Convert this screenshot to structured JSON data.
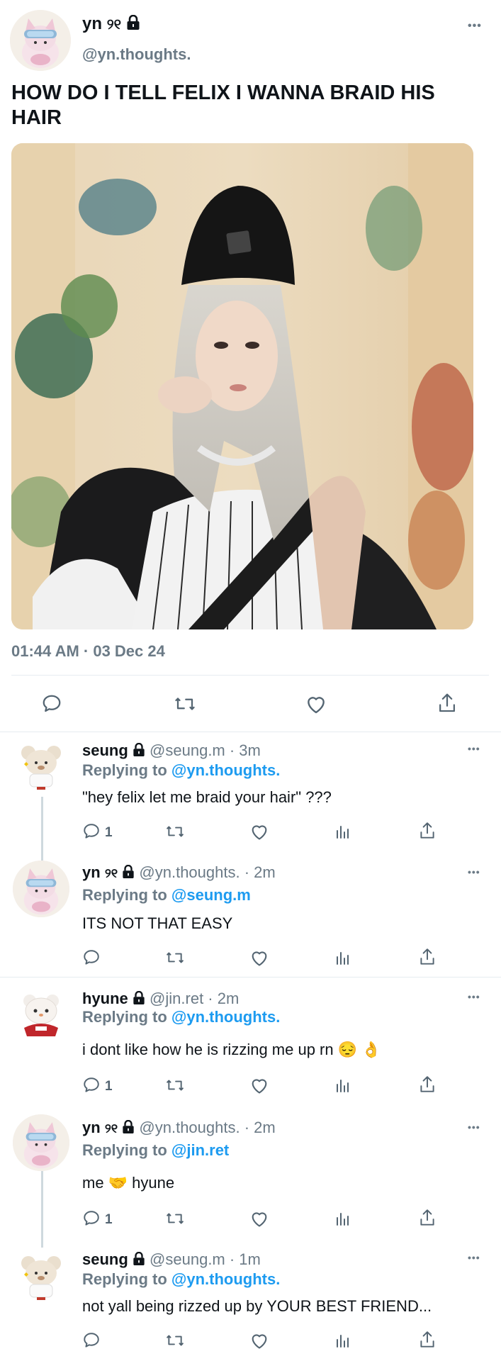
{
  "main_tweet": {
    "display_name": "yn",
    "name_symbol": "୨୧",
    "handle": "@yn.thoughts.",
    "text": "HOW DO I TELL FELIX I WANNA BRAID HIS HAIR",
    "timestamp": "01:44 AM · 03 Dec 24",
    "more": "•••"
  },
  "replies": [
    {
      "display_name": "seung",
      "handle_time": "@seung.m · 3m",
      "replying_label": "Replying to",
      "replying_to": "@yn.thoughts.",
      "text": "\"hey felix let me braid your hair\" ???",
      "reply_count": "1",
      "more": "•••"
    },
    {
      "display_name": "yn",
      "name_symbol": "୨୧",
      "handle_time": "@yn.thoughts. · 2m",
      "replying_label": "Replying to",
      "replying_to": "@seung.m",
      "text": "ITS NOT THAT EASY",
      "reply_count": "",
      "more": "•••"
    },
    {
      "display_name": "hyune",
      "handle_time": "@jin.ret · 2m",
      "replying_label": "Replying to",
      "replying_to": "@yn.thoughts.",
      "text": "i dont like how he is rizzing me up rn 😔 👌",
      "reply_count": "1",
      "more": "•••"
    },
    {
      "display_name": "yn",
      "name_symbol": "୨୧",
      "handle_time": "@yn.thoughts. · 2m",
      "replying_label": "Replying to",
      "replying_to": "@jin.ret",
      "text": "me 🤝 hyune",
      "reply_count": "1",
      "more": "•••"
    },
    {
      "display_name": "seung",
      "handle_time": "@seung.m · 1m",
      "replying_label": "Replying to",
      "replying_to": "@yn.thoughts.",
      "text": "not yall being rizzed up by YOUR BEST FRIEND...",
      "reply_count": "",
      "more": "•••"
    }
  ],
  "colors": {
    "link": "#1d9bf0",
    "muted": "#6b7a86",
    "text": "#0f1419"
  },
  "icons": [
    "comment-icon",
    "retweet-icon",
    "like-icon",
    "share-icon",
    "analytics-icon",
    "lock-icon",
    "more-icon"
  ]
}
